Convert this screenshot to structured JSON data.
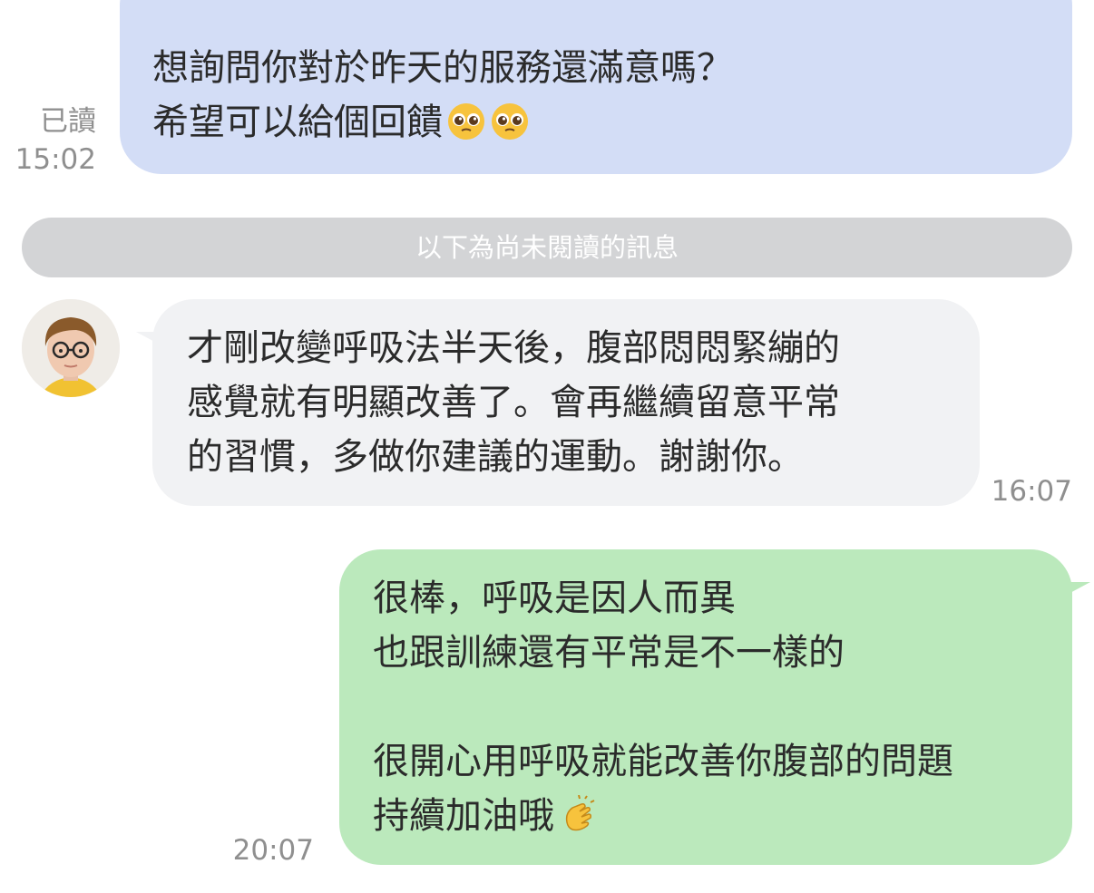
{
  "messages": {
    "sent_1": {
      "line1": "想詢問你對於昨天的服務還滿意嗎？",
      "line2": "希望可以給個回饋",
      "emoji": "pleading-face-emoji",
      "read_label": "已讀",
      "time": "15:02"
    },
    "divider_label": "以下為尚未閱讀的訊息",
    "received_1": {
      "text": "才剛改變呼吸法半天後，腹部悶悶緊繃的\n感覺就有明顯改善了。會再繼續留意平常\n的習慣，多做你建議的運動。謝謝你。",
      "time": "16:07"
    },
    "sent_2": {
      "text": "很棒，呼吸是因人而異\n也跟訓練還有平常是不一樣的\n\n很開心用呼吸就能改善你腹部的問題\n持續加油哦",
      "emoji": "clapping-hands-emoji",
      "time": "20:07"
    }
  },
  "colors": {
    "sent_bubble_blue": "#d3ddf6",
    "received_bubble": "#f1f2f4",
    "sent_bubble_green": "#bbe9bc",
    "divider": "#d3d4d6",
    "meta_text": "#8f8f8f"
  }
}
